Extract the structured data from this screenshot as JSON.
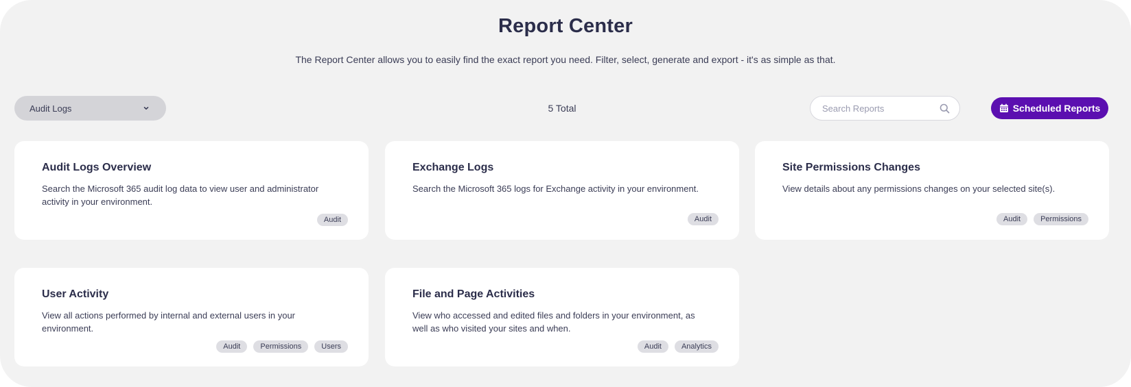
{
  "header": {
    "title": "Report Center",
    "subtitle": "The Report Center allows you to easily find the exact report you need. Filter, select, generate and export - it's as simple as that."
  },
  "toolbar": {
    "category_value": "Audit Logs",
    "total_label": "5 Total",
    "search_placeholder": "Search Reports",
    "scheduled_label": "Scheduled Reports"
  },
  "reports": [
    {
      "title": "Audit Logs Overview",
      "description": "Search the Microsoft 365 audit log data to view user and administrator activity in your environment.",
      "tags": [
        "Audit"
      ]
    },
    {
      "title": "Exchange Logs",
      "description": "Search the Microsoft 365 logs for Exchange activity in your environment.",
      "tags": [
        "Audit"
      ]
    },
    {
      "title": "Site Permissions Changes",
      "description": "View details about any permissions changes on your selected site(s).",
      "tags": [
        "Audit",
        "Permissions"
      ]
    },
    {
      "title": "User Activity",
      "description": "View all actions performed by internal and external users in your environment.",
      "tags": [
        "Audit",
        "Permissions",
        "Users"
      ]
    },
    {
      "title": "File and Page Activities",
      "description": "View who accessed and edited files and folders in your environment, as well as who visited your sites and when.",
      "tags": [
        "Audit",
        "Analytics"
      ]
    }
  ],
  "icons": {
    "dropdown": "chevron-down-icon",
    "search": "search-icon",
    "schedule": "calendar-icon"
  },
  "colors": {
    "accent": "#5b0fb0",
    "background": "#f2f2f2",
    "card": "#ffffff",
    "tag": "#dedee3",
    "text": "#2b2d4a"
  }
}
